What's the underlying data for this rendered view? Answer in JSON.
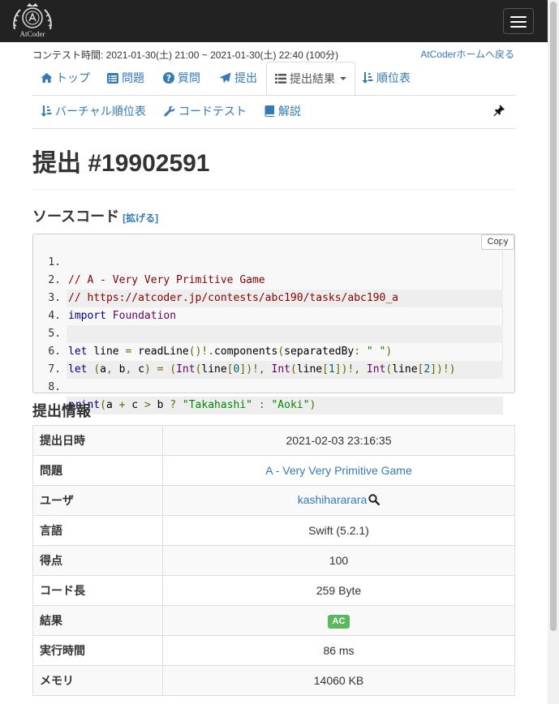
{
  "navbar": {
    "logo_text": "AtCoder"
  },
  "contest": {
    "time_text": "コンテスト時間: 2021-01-30(土) 21:00 ~ 2021-01-30(土) 22:40 (100分)",
    "home_link": "AtCoderホームへ戻る"
  },
  "tabs": {
    "top": "トップ",
    "problems": "問題",
    "questions": "質問",
    "submit": "提出",
    "results": "提出結果",
    "standings": "順位表",
    "virtual_standings": "バーチャル順位表",
    "code_test": "コードテスト",
    "editorial": "解説"
  },
  "submission": {
    "title": "提出 #19902591",
    "source_heading": "ソースコード",
    "expand_link": "[拡げる]",
    "copy_label": "Copy",
    "info_heading": "提出情報"
  },
  "code_lines": [
    "// A - Very Very Primitive Game",
    "// https://atcoder.jp/contests/abc190/tasks/abc190_a",
    "import Foundation",
    "",
    "let line = readLine()!.components(separatedBy: \" \")",
    "let (a, b, c) = (Int(line[0])!, Int(line[1])!, Int(line[2])!)",
    "",
    "print(a + c > b ? \"Takahashi\" : \"Aoki\")"
  ],
  "info": {
    "submit_time_label": "提出日時",
    "submit_time": "2021-02-03 23:16:35",
    "task_label": "問題",
    "task": "A - Very Very Primitive Game",
    "user_label": "ユーザ",
    "user": "kashihararara",
    "language_label": "言語",
    "language": "Swift (5.2.1)",
    "score_label": "得点",
    "score": "100",
    "code_length_label": "コード長",
    "code_length": "259 Byte",
    "result_label": "結果",
    "result": "AC",
    "exec_time_label": "実行時間",
    "exec_time": "86 ms",
    "memory_label": "メモリ",
    "memory": "14060 KB"
  },
  "colors": {
    "navbar": "#222222",
    "link": "#337ab7",
    "ac_badge": "#5cb85c"
  }
}
